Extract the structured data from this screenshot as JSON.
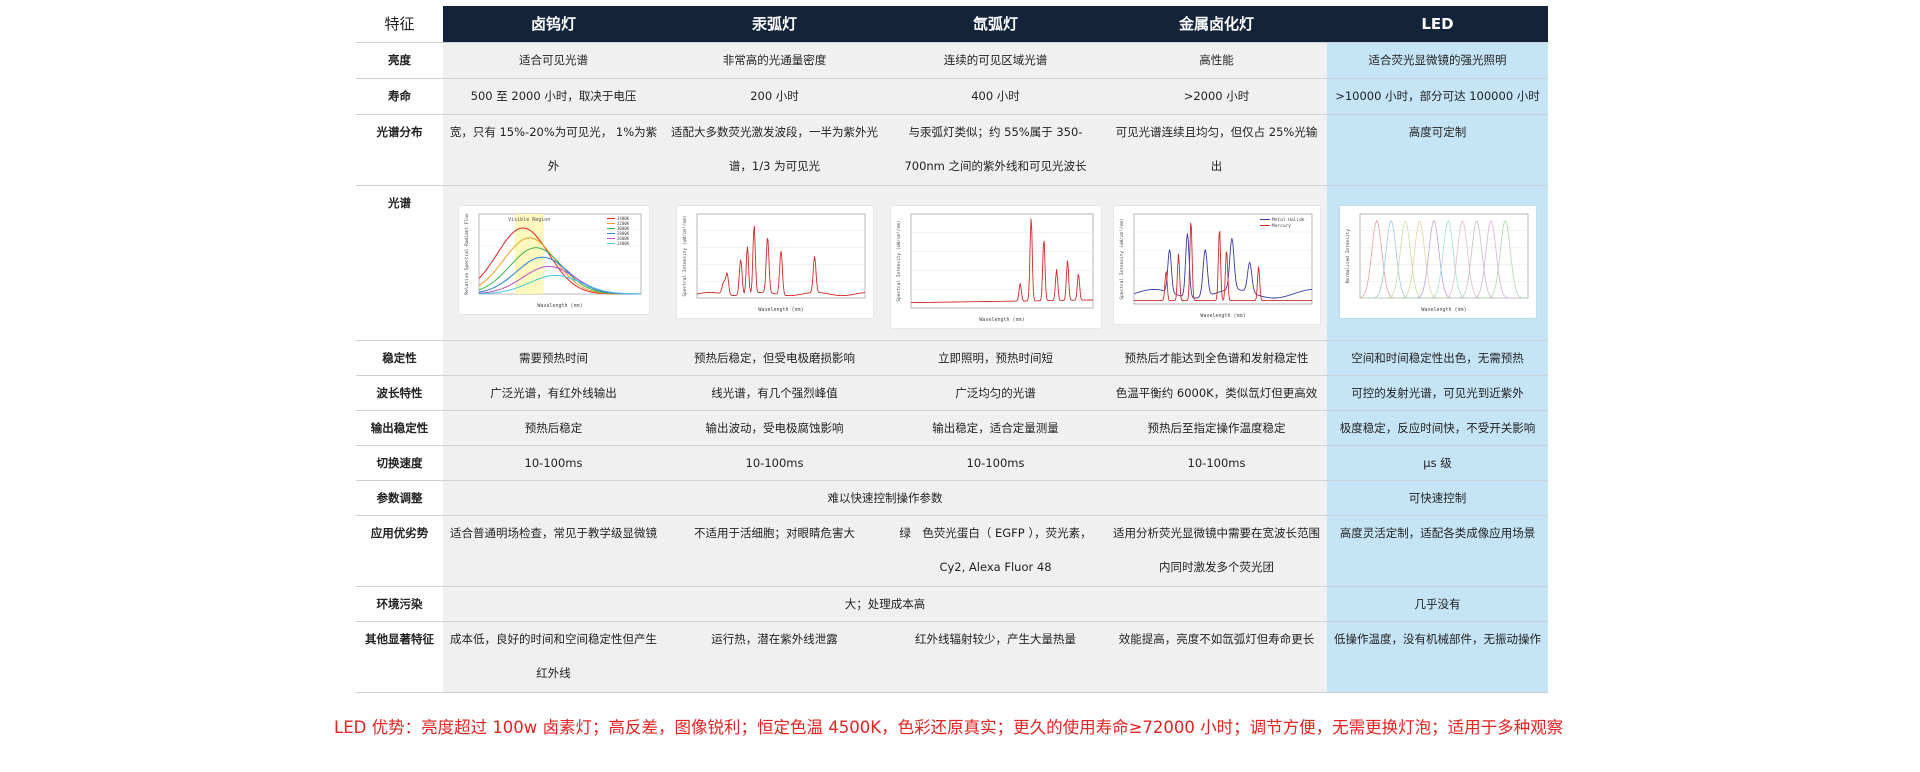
{
  "header": {
    "feature": "特征",
    "columns": [
      "卤钨灯",
      "汞弧灯",
      "氙弧灯",
      "金属卤化灯",
      "LED"
    ]
  },
  "rows": {
    "brightness": {
      "label": "亮度",
      "cells": [
        "适合可见光谱",
        "非常高的光通量密度",
        "连续的可见区域光谱",
        "高性能",
        "适合荧光显微镜的强光照明"
      ]
    },
    "lifetime": {
      "label": "寿命",
      "cells": [
        "500 至 2000 小时，取决于电压",
        "200 小时",
        "400 小时",
        ">2000 小时",
        ">10000 小时，部分可达 100000 小时"
      ]
    },
    "spectral_distribution": {
      "label": "光谱分布",
      "cells": [
        "宽，只有 15%-20%为可见光， 1%为紫外",
        "适配大多数荧光激发波段，一半为紫外光谱，1/3 为可见光",
        "与汞弧灯类似；约 55%属于 350-700nm 之间的紫外线和可见光波长",
        "可见光谱连续且均匀，但仅占 25%光输出",
        "高度可定制"
      ]
    },
    "spectrum": {
      "label": "光谱",
      "plots": [
        {
          "title": "Visible Region",
          "xlabel": "Wavelength (nm)",
          "ylabel": "Relative Spectral Radiant Flux",
          "legend": [
            "3400K",
            "3200K",
            "3000K",
            "2800K",
            "2600K",
            "2400K"
          ],
          "colors": [
            "#e52321",
            "#f0a020",
            "#3db54a",
            "#2a7fd4",
            "#c24bd1",
            "#40c8e0"
          ]
        },
        {
          "xlabel": "Wavelength (nm)",
          "ylabel": "Spectral Intensity (uW/cm²/nm)",
          "colors": [
            "#d22a2a"
          ]
        },
        {
          "xlabel": "Wavelength (nm)",
          "ylabel": "Spectral Intensity (uW/cm²/nm)",
          "colors": [
            "#d22a2a"
          ]
        },
        {
          "xlabel": "Wavelength (nm)",
          "ylabel": "Spectral Intensity (uW/cm²/nm)",
          "legend": [
            "Metal Halide",
            "Mercury"
          ],
          "colors": [
            "#3a3aa8",
            "#d22a2a"
          ]
        },
        {
          "xlabel": "Wavelength (nm)",
          "ylabel": "Normalized Intensity",
          "colors": [
            "#e8a0a0",
            "#a0c8e8",
            "#c8e0a0",
            "#e8d0a0",
            "#c0a0e0",
            "#a0e0d0",
            "#e0c0c0",
            "#c0c0c0",
            "#d8b0d8",
            "#b0d8b0"
          ]
        }
      ]
    },
    "stability": {
      "label": "稳定性",
      "cells": [
        "需要预热时间",
        "预热后稳定，但受电极磨损影响",
        "立即照明，预热时间短",
        "预热后才能达到全色谱和发射稳定性",
        "空间和时间稳定性出色，无需预热"
      ]
    },
    "wavelength": {
      "label": "波长特性",
      "cells": [
        "广泛光谱，有红外线输出",
        "线光谱，有几个强烈峰值",
        "广泛均匀的光谱",
        "色温平衡约 6000K，类似氙灯但更高效",
        "可控的发射光谱，可见光到近紫外"
      ]
    },
    "output_stability": {
      "label": "输出稳定性",
      "cells": [
        "预热后稳定",
        "输出波动，受电极腐蚀影响",
        "输出稳定，适合定量测量",
        "预热后至指定操作温度稳定",
        "极度稳定，反应时间快，不受开关影响"
      ]
    },
    "switch_speed": {
      "label": "切换速度",
      "cells": [
        "10-100ms",
        "10-100ms",
        "10-100ms",
        "10-100ms",
        "μs 级"
      ]
    },
    "parameter": {
      "label": "参数调整",
      "merged": "难以快速控制操作参数",
      "led": "可快速控制"
    },
    "application": {
      "label": "应用优劣势",
      "cells": [
        "适合普通明场检查，常见于教学级显微镜",
        "不适用于活细胞；对眼睛危害大",
        "绿　色荧光蛋白（ EGFP ），荧光素，Cy2, Alexa Fluor 48",
        "适用分析荧光显微镜中需要在宽波长范围内同时激发多个荧光团",
        "高度灵活定制，适配各类成像应用场景"
      ]
    },
    "pollution": {
      "label": "环境污染",
      "merged": "大；处理成本高",
      "led": "几乎没有"
    },
    "other": {
      "label": "其他显著特征",
      "cells": [
        "成本低，良好的时间和空间稳定性但产生红外线",
        "运行热，潜在紫外线泄露",
        "红外线辐射较少，产生大量热量",
        "效能提高，亮度不如氙弧灯但寿命更长",
        "低操作温度，没有机械部件，无振动操作"
      ]
    }
  },
  "footnote": "LED 优势：亮度超过 100w 卤素灯；高反差，图像锐利；恒定色温 4500K，色彩还原真实；更久的使用寿命≥72000 小时；调节方便，无需更换灯泡；适用于多种观察"
}
